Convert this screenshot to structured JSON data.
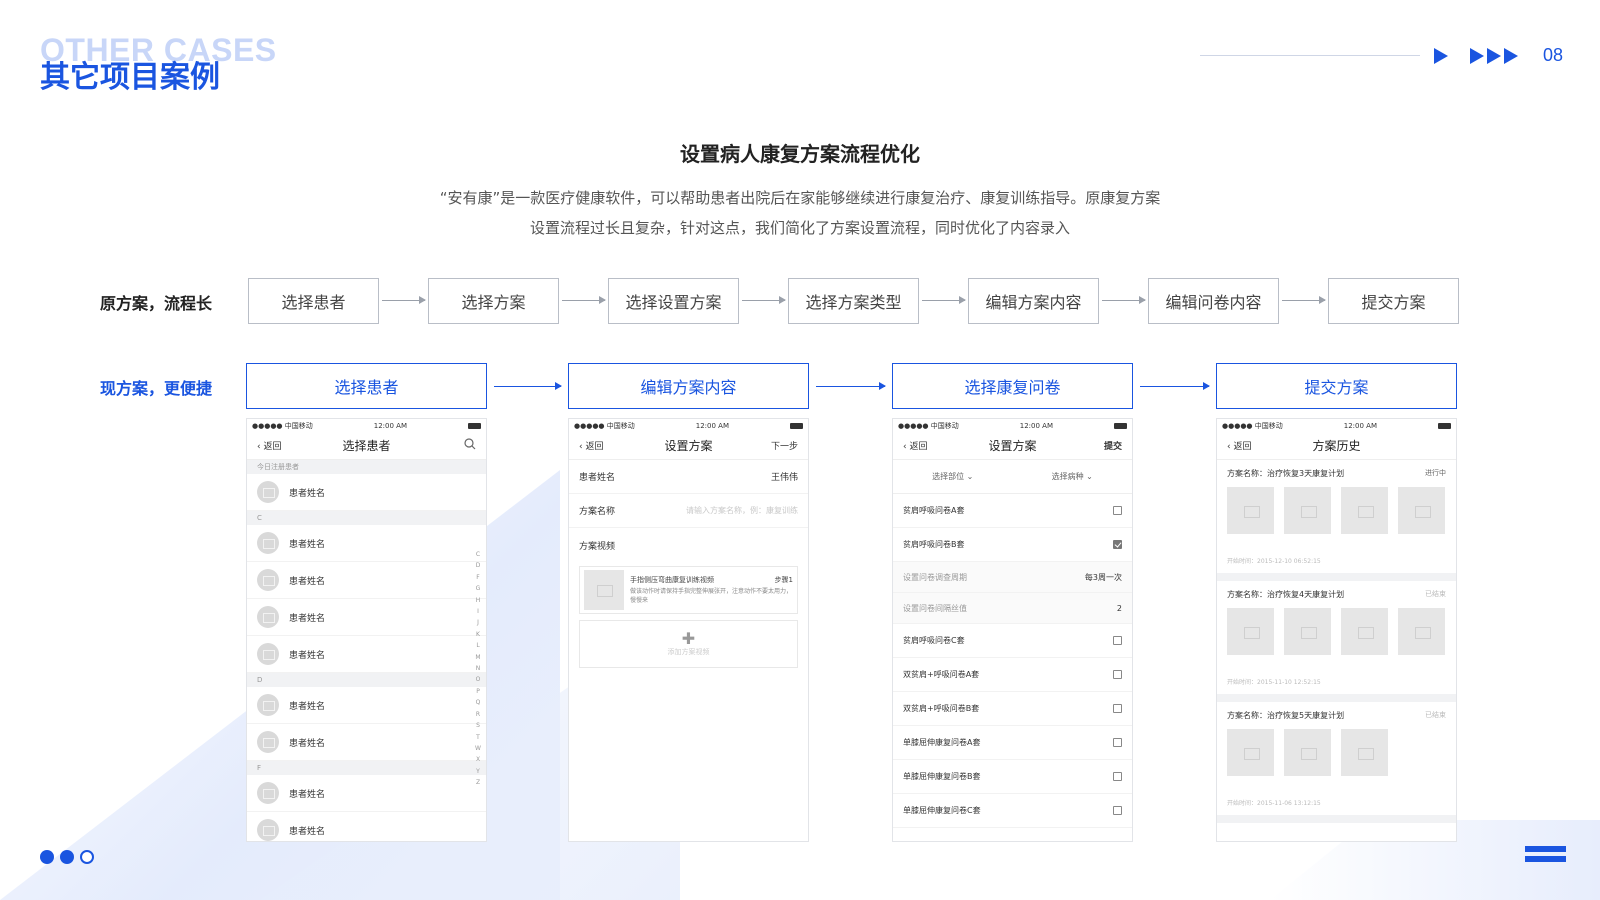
{
  "header": {
    "title_en": "OTHER CASES",
    "title_cn": "其它项目案例",
    "page_number": "08"
  },
  "section": {
    "title": "设置病人康复方案流程优化",
    "description_line1": "“安有康”是一款医疗健康软件，可以帮助患者出院后在家能够继续进行康复治疗、康复训练指导。原康复方案",
    "description_line2": "设置流程过长且复杂，针对这点，我们简化了方案设置流程，同时优化了内容录入"
  },
  "old_flow": {
    "label": "原方案，流程长",
    "steps": [
      "选择患者",
      "选择方案",
      "选择设置方案",
      "选择方案类型",
      "编辑方案内容",
      "编辑问卷内容",
      "提交方案"
    ]
  },
  "new_flow": {
    "label": "现方案，更便捷",
    "steps": [
      "选择患者",
      "编辑方案内容",
      "选择康复问卷",
      "提交方案"
    ]
  },
  "status_bar": {
    "carrier": "●●●●● 中国移动",
    "time": "12:00 AM"
  },
  "phone1": {
    "back": "返回",
    "title": "选择患者",
    "sections": [
      {
        "header": "今日注册患者",
        "patients": [
          "患者姓名"
        ]
      },
      {
        "header": "C",
        "patients": [
          "患者姓名",
          "患者姓名",
          "患者姓名",
          "患者姓名"
        ]
      },
      {
        "header": "D",
        "patients": [
          "患者姓名",
          "患者姓名"
        ]
      },
      {
        "header": "F",
        "patients": [
          "患者姓名",
          "患者姓名"
        ]
      }
    ],
    "alphabet": [
      "C",
      "D",
      "F",
      "G",
      "H",
      "I",
      "J",
      "K",
      "L",
      "M",
      "N",
      "O",
      "P",
      "Q",
      "R",
      "S",
      "T",
      "W",
      "X",
      "Y",
      "Z"
    ]
  },
  "phone2": {
    "back": "返回",
    "title": "设置方案",
    "right": "下一步",
    "patient_label": "患者姓名",
    "patient_value": "王伟伟",
    "plan_label": "方案名称",
    "plan_placeholder": "请输入方案名称，例：康复训练",
    "video_label": "方案视频",
    "video_title": "手指侧压弯曲康复训练视频",
    "video_step": "步骤1",
    "video_desc": "做该动作时请保持手指完整伸展张开，注意动作不要太用力，慢慢来",
    "add_video": "添加方案视频"
  },
  "phone3": {
    "back": "返回",
    "title": "设置方案",
    "right": "提交",
    "filter1": "选择部位",
    "filter2": "选择病种",
    "rows": [
      {
        "label": "贫肩呼吸问卷A套",
        "type": "check",
        "checked": false
      },
      {
        "label": "贫肩呼吸问卷B套",
        "type": "check",
        "checked": true
      },
      {
        "label": "设置问卷调查周期",
        "type": "value",
        "value": "每3周一次"
      },
      {
        "label": "设置问卷间隔丝值",
        "type": "value",
        "value": "2"
      },
      {
        "label": "贫肩呼吸问卷C套",
        "type": "check",
        "checked": false
      },
      {
        "label": "双贫肩+呼吸问卷A套",
        "type": "check",
        "checked": false
      },
      {
        "label": "双贫肩+呼吸问卷B套",
        "type": "check",
        "checked": false
      },
      {
        "label": "单膝屈伸康复问卷A套",
        "type": "check",
        "checked": false
      },
      {
        "label": "单膝屈伸康复问卷B套",
        "type": "check",
        "checked": false
      },
      {
        "label": "单膝屈伸康复问卷C套",
        "type": "check",
        "checked": false
      }
    ]
  },
  "phone4": {
    "back": "返回",
    "title": "方案历史",
    "cards": [
      {
        "name": "方案名称：治疗恢复3天康复计划",
        "status": "进行中",
        "images": 4,
        "time": "开始时间：2015-12-10 06:52:15"
      },
      {
        "name": "方案名称：治疗恢复4天康复计划",
        "status": "已结束",
        "images": 4,
        "time": "开始时间：2015-11-10 12:52:15"
      },
      {
        "name": "方案名称：治疗恢复5天康复计划",
        "status": "已结束",
        "images": 3,
        "time": "开始时间：2015-11-06 13:12:15"
      }
    ]
  },
  "colors": {
    "accent": "#1a55e0",
    "border_gray": "#b9bec7",
    "text_dark": "#222222"
  }
}
